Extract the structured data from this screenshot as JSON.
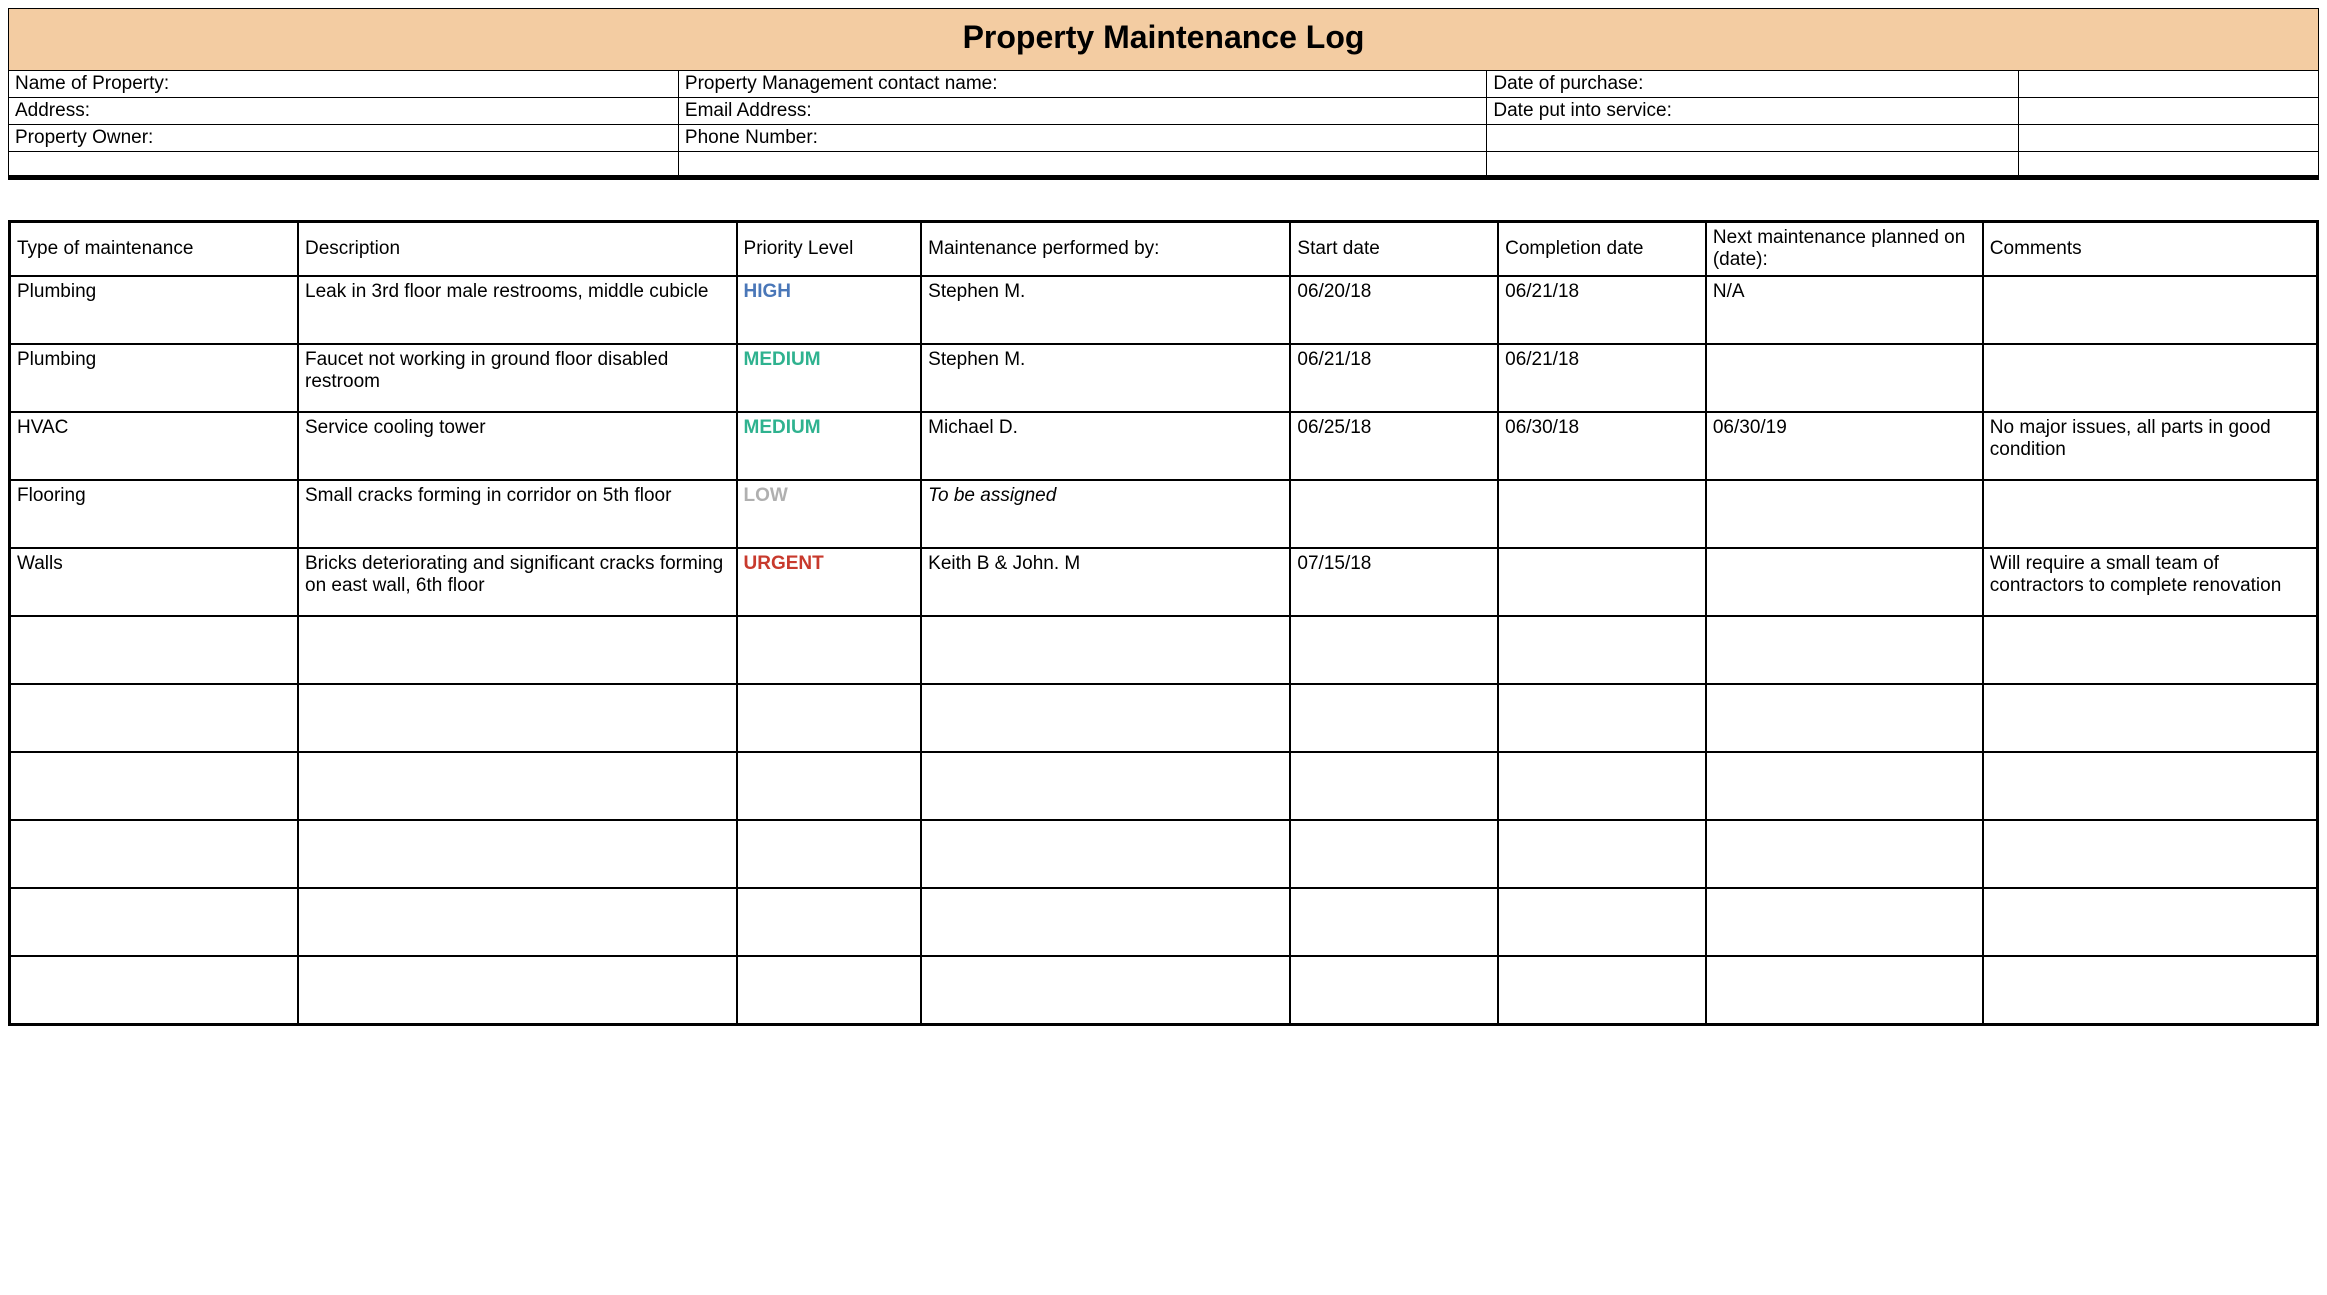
{
  "title": "Property Maintenance Log",
  "info": {
    "row1": {
      "c1": "Name of Property:",
      "c2": "Property Management contact name:",
      "c3": "Date of purchase:",
      "c4": ""
    },
    "row2": {
      "c1": "Address:",
      "c2": "Email Address:",
      "c3": "Date put into service:",
      "c4": ""
    },
    "row3": {
      "c1": "Property Owner:",
      "c2": "Phone Number:",
      "c3": "",
      "c4": ""
    },
    "row4": {
      "c1": "",
      "c2": "",
      "c3": "",
      "c4": ""
    }
  },
  "headers": {
    "type": "Type of maintenance",
    "desc": "Description",
    "prio": "Priority Level",
    "perf": "Maintenance performed by:",
    "start": "Start date",
    "comp": "Completion date",
    "next": "Next maintenance planned on (date):",
    "comm": "Comments"
  },
  "rows": [
    {
      "type": "Plumbing",
      "desc": "Leak in 3rd floor male restrooms, middle cubicle",
      "prio": "HIGH",
      "prio_class": "prio-high",
      "perf": "Stephen M.",
      "perf_italic": false,
      "start": "06/20/18",
      "comp": "06/21/18",
      "next": "N/A",
      "comm": ""
    },
    {
      "type": "Plumbing",
      "desc": "Faucet not working in ground floor disabled restroom",
      "prio": "MEDIUM",
      "prio_class": "prio-medium",
      "perf": "Stephen M.",
      "perf_italic": false,
      "start": "06/21/18",
      "comp": "06/21/18",
      "next": "",
      "comm": ""
    },
    {
      "type": "HVAC",
      "desc": "Service cooling tower",
      "prio": "MEDIUM",
      "prio_class": "prio-medium",
      "perf": "Michael D.",
      "perf_italic": false,
      "start": "06/25/18",
      "comp": "06/30/18",
      "next": "06/30/19",
      "comm": "No major issues, all parts in good condition"
    },
    {
      "type": "Flooring",
      "desc": "Small cracks forming in corridor on 5th floor",
      "prio": "LOW",
      "prio_class": "prio-low",
      "perf": "To be assigned",
      "perf_italic": true,
      "start": "",
      "comp": "",
      "next": "",
      "comm": ""
    },
    {
      "type": "Walls",
      "desc": "Bricks deteriorating and significant cracks forming on east wall, 6th floor",
      "prio": "URGENT",
      "prio_class": "prio-urgent",
      "perf": "Keith B & John. M",
      "perf_italic": false,
      "start": "07/15/18",
      "comp": "",
      "next": "",
      "comm": "Will require a small team of contractors to complete renovation"
    },
    {
      "type": "",
      "desc": "",
      "prio": "",
      "prio_class": "",
      "perf": "",
      "perf_italic": false,
      "start": "",
      "comp": "",
      "next": "",
      "comm": ""
    },
    {
      "type": "",
      "desc": "",
      "prio": "",
      "prio_class": "",
      "perf": "",
      "perf_italic": false,
      "start": "",
      "comp": "",
      "next": "",
      "comm": ""
    },
    {
      "type": "",
      "desc": "",
      "prio": "",
      "prio_class": "",
      "perf": "",
      "perf_italic": false,
      "start": "",
      "comp": "",
      "next": "",
      "comm": ""
    },
    {
      "type": "",
      "desc": "",
      "prio": "",
      "prio_class": "",
      "perf": "",
      "perf_italic": false,
      "start": "",
      "comp": "",
      "next": "",
      "comm": ""
    },
    {
      "type": "",
      "desc": "",
      "prio": "",
      "prio_class": "",
      "perf": "",
      "perf_italic": false,
      "start": "",
      "comp": "",
      "next": "",
      "comm": ""
    },
    {
      "type": "",
      "desc": "",
      "prio": "",
      "prio_class": "",
      "perf": "",
      "perf_italic": false,
      "start": "",
      "comp": "",
      "next": "",
      "comm": ""
    }
  ]
}
